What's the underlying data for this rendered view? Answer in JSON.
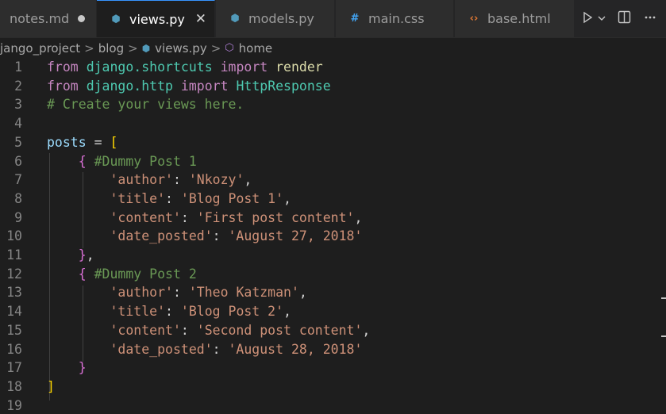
{
  "tabs": [
    {
      "label": "notes.md",
      "icon": "markdown-icon",
      "state": "modified"
    },
    {
      "label": "views.py",
      "icon": "python-icon",
      "state": "active"
    },
    {
      "label": "models.py",
      "icon": "python-icon",
      "state": "normal"
    },
    {
      "label": "main.css",
      "icon": "css-hash-icon",
      "state": "normal"
    },
    {
      "label": "base.html",
      "icon": "html-code-icon",
      "state": "normal"
    }
  ],
  "tab_actions": [
    "run-play-icon",
    "chevron-down-icon",
    "split-editor-icon",
    "more-actions-icon"
  ],
  "breadcrumb": {
    "items": [
      "jango_project",
      "blog",
      "views.py",
      "home"
    ],
    "separator": ">"
  },
  "editor": {
    "line_numbers": [
      "1",
      "2",
      "3",
      "4",
      "5",
      "6",
      "7",
      "8",
      "9",
      "10",
      "11",
      "12",
      "13",
      "14",
      "15",
      "16",
      "17",
      "18",
      "19"
    ],
    "lines": [
      [
        [
          "kw",
          "from"
        ],
        [
          "op",
          " "
        ],
        [
          "mod",
          "django.shortcuts"
        ],
        [
          "op",
          " "
        ],
        [
          "kw",
          "import"
        ],
        [
          "op",
          " "
        ],
        [
          "fn",
          "render"
        ]
      ],
      [
        [
          "kw",
          "from"
        ],
        [
          "op",
          " "
        ],
        [
          "mod",
          "django.http"
        ],
        [
          "op",
          " "
        ],
        [
          "kw",
          "import"
        ],
        [
          "op",
          " "
        ],
        [
          "cls",
          "HttpResponse"
        ]
      ],
      [
        [
          "cm",
          "# Create your views here."
        ]
      ],
      [],
      [
        [
          "var",
          "posts"
        ],
        [
          "op",
          " = "
        ],
        [
          "br1",
          "["
        ]
      ],
      [
        [
          "op",
          "    "
        ],
        [
          "br2",
          "{"
        ],
        [
          "op",
          " "
        ],
        [
          "cm",
          "#Dummy Post 1"
        ]
      ],
      [
        [
          "op",
          "        "
        ],
        [
          "str",
          "'author'"
        ],
        [
          "op",
          ": "
        ],
        [
          "str",
          "'Nkozy'"
        ],
        [
          "op",
          ","
        ]
      ],
      [
        [
          "op",
          "        "
        ],
        [
          "str",
          "'title'"
        ],
        [
          "op",
          ": "
        ],
        [
          "str",
          "'Blog Post 1'"
        ],
        [
          "op",
          ","
        ]
      ],
      [
        [
          "op",
          "        "
        ],
        [
          "str",
          "'content'"
        ],
        [
          "op",
          ": "
        ],
        [
          "str",
          "'First post content'"
        ],
        [
          "op",
          ","
        ]
      ],
      [
        [
          "op",
          "        "
        ],
        [
          "str",
          "'date_posted'"
        ],
        [
          "op",
          ": "
        ],
        [
          "str",
          "'August 27, 2018'"
        ]
      ],
      [
        [
          "op",
          "    "
        ],
        [
          "br2",
          "}"
        ],
        [
          "op",
          ","
        ]
      ],
      [
        [
          "op",
          "    "
        ],
        [
          "br2",
          "{"
        ],
        [
          "op",
          " "
        ],
        [
          "cm",
          "#Dummy Post 2"
        ]
      ],
      [
        [
          "op",
          "        "
        ],
        [
          "str",
          "'author'"
        ],
        [
          "op",
          ": "
        ],
        [
          "str",
          "'Theo Katzman'"
        ],
        [
          "op",
          ","
        ]
      ],
      [
        [
          "op",
          "        "
        ],
        [
          "str",
          "'title'"
        ],
        [
          "op",
          ": "
        ],
        [
          "str",
          "'Blog Post 2'"
        ],
        [
          "op",
          ","
        ]
      ],
      [
        [
          "op",
          "        "
        ],
        [
          "str",
          "'content'"
        ],
        [
          "op",
          ": "
        ],
        [
          "str",
          "'Second post content'"
        ],
        [
          "op",
          ","
        ]
      ],
      [
        [
          "op",
          "        "
        ],
        [
          "str",
          "'date_posted'"
        ],
        [
          "op",
          ": "
        ],
        [
          "str",
          "'August 28, 2018'"
        ]
      ],
      [
        [
          "op",
          "    "
        ],
        [
          "br2",
          "}"
        ]
      ],
      [
        [
          "br1",
          "]"
        ]
      ],
      []
    ]
  },
  "colors": {
    "background": "#1e1e1e",
    "tab_active_accent": "#3794ff",
    "keyword": "#c586c0",
    "module": "#4ec9b0",
    "function": "#dcdcaa",
    "comment": "#6a9955",
    "variable": "#9cdcfe",
    "string": "#ce9178",
    "bracket_outer": "#ffd700",
    "bracket_inner": "#da70d6"
  }
}
